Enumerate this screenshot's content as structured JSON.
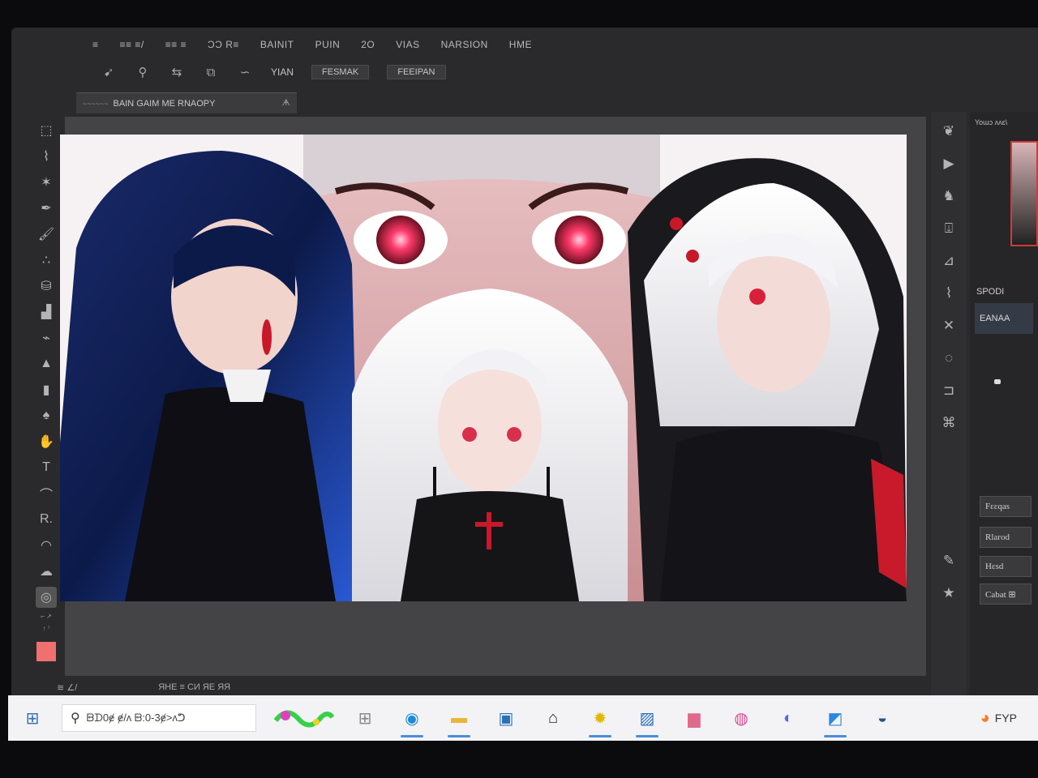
{
  "menu": [
    "≡",
    "≡≡ ≡/",
    "≡≡ ≡",
    "ƆƆ R≡",
    "BAINIT",
    "PUIN",
    "2O",
    "VIAS",
    "NARSION",
    "HME"
  ],
  "options": {
    "icons": [
      "move-icon",
      "zoom-icon",
      "transform-icon",
      "crop-icon",
      "lasso-icon"
    ],
    "plain_label": "YIAN",
    "btn1": "FESMAK",
    "btn2": "FEEIPAN"
  },
  "doc_tab": {
    "prefix": "~~~~~~",
    "title": "BAIN GAIM ME RNAOPY",
    "close": "ᗗ"
  },
  "tools": [
    {
      "name": "tool-marquee-icon",
      "glyph": "⬚"
    },
    {
      "name": "tool-lasso-icon",
      "glyph": "⌇"
    },
    {
      "name": "tool-wand-icon",
      "glyph": "✶"
    },
    {
      "name": "tool-pen-icon",
      "glyph": "✒"
    },
    {
      "name": "tool-brush-icon",
      "glyph": "🖌"
    },
    {
      "name": "tool-dots-icon",
      "glyph": "∴"
    },
    {
      "name": "tool-stamp-icon",
      "glyph": "⛁"
    },
    {
      "name": "tool-bucket-icon",
      "glyph": "▟"
    },
    {
      "name": "tool-eyedrop-icon",
      "glyph": "⌁"
    },
    {
      "name": "tool-triangle-icon",
      "glyph": "▲"
    },
    {
      "name": "tool-gradient-icon",
      "glyph": "▮"
    },
    {
      "name": "tool-blur-icon",
      "glyph": "♠"
    },
    {
      "name": "tool-dodge-icon",
      "glyph": "✋"
    },
    {
      "name": "tool-type-icon",
      "glyph": "T"
    },
    {
      "name": "tool-path-icon",
      "glyph": "⌒"
    },
    {
      "name": "tool-select-icon",
      "glyph": "R."
    },
    {
      "name": "tool-shape-icon",
      "glyph": "◠"
    },
    {
      "name": "tool-hand-icon",
      "glyph": "☁"
    },
    {
      "name": "tool-zoom-icon",
      "glyph": "◎"
    }
  ],
  "toolbar_label1": "⌐ ↗",
  "toolbar_label2": "↑ ⁷",
  "status": {
    "left": "≋ ∠/",
    "right": "ЯНЕ ≡ CИ ЯЕ ЯЯ"
  },
  "right_icons": [
    "brush-settings-icon",
    "play-icon",
    "figure-icon",
    "clone-icon",
    "ruler-icon",
    "brush-icon",
    "close-icon",
    "swirl-icon",
    "frame-icon",
    "character-icon",
    "pen-icon",
    "star-icon"
  ],
  "right_panel": {
    "title": "Yoɯɔ ʌʌɛ\\",
    "label": "SPODI",
    "field": "EANAA",
    "layers": [
      "Fɛɛqas",
      "Rlarod",
      "Hɛsd",
      "Cabat ⊞"
    ]
  },
  "taskbar": {
    "start_glyph": "⊞",
    "search_text": "ᗸᗪ0ɇ ɇ/ʌ ᗸ:0-3ɇ>ʌᕤ",
    "apps": [
      {
        "name": "taskbar-app-grid",
        "glyph": "⊞",
        "color": "#888888",
        "bar": false
      },
      {
        "name": "taskbar-app-edge",
        "glyph": "◉",
        "color": "#1c8ad6",
        "bar": true
      },
      {
        "name": "taskbar-app-folder",
        "glyph": "▬",
        "color": "#e8b63a",
        "bar": true
      },
      {
        "name": "taskbar-app-store",
        "glyph": "▣",
        "color": "#2a6fb8",
        "bar": false
      },
      {
        "name": "taskbar-app-terminal",
        "glyph": "⌂",
        "color": "#222222",
        "bar": false
      },
      {
        "name": "taskbar-app-sun",
        "glyph": "✹",
        "color": "#e0b800",
        "bar": true
      },
      {
        "name": "taskbar-app-paint",
        "glyph": "▨",
        "color": "#2870c0",
        "bar": true
      },
      {
        "name": "taskbar-app-photos",
        "glyph": "▆",
        "color": "#e06a8a",
        "bar": false
      },
      {
        "name": "taskbar-app-clock",
        "glyph": "◍",
        "color": "#e04a8a",
        "bar": false
      },
      {
        "name": "taskbar-app-compass",
        "glyph": "◐",
        "color": "#5a6adc",
        "bar": false
      },
      {
        "name": "taskbar-app-image",
        "glyph": "◩",
        "color": "#2a88dd",
        "bar": true
      },
      {
        "name": "taskbar-app-steam",
        "glyph": "◒",
        "color": "#2a4e8a",
        "bar": false
      }
    ],
    "tray_text": "FYP"
  }
}
